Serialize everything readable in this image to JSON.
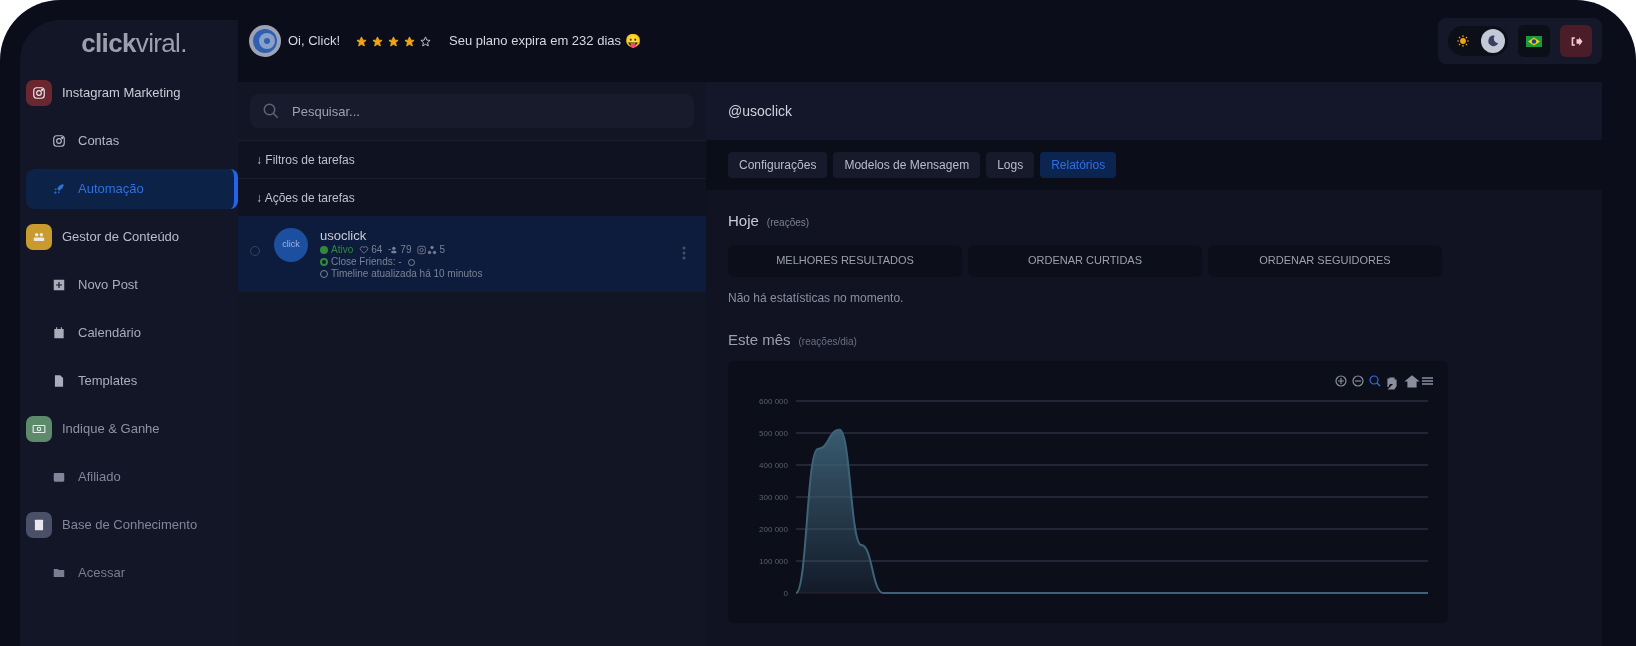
{
  "sidebar": {
    "logo": "**click**viral.",
    "groups": [
      {
        "title": "Instagram Marketing",
        "color": "#6b2630",
        "children": [
          {
            "label": "Contas",
            "selected": false
          },
          {
            "label": "Automação",
            "selected": true
          }
        ]
      },
      {
        "title": "Gestor de Conteúdo",
        "color": "#c99a2e",
        "children": [
          {
            "label": "Novo Post",
            "selected": false
          },
          {
            "label": "Calendário",
            "selected": false
          },
          {
            "label": "Templates",
            "selected": false
          }
        ]
      },
      {
        "title": "Indique & Ganhe",
        "color": "#5c8a6a",
        "children": [
          {
            "label": "Afiliado",
            "selected": false
          }
        ]
      },
      {
        "title": "Base de Conhecimento",
        "color": "#4a5068",
        "children": [
          {
            "label": "Acessar",
            "selected": false
          }
        ]
      }
    ]
  },
  "header": {
    "greeting": "Oi, Click!",
    "stars": 4,
    "plan": "Seu plano expira em 232 dias 😛",
    "theme_toggle": {
      "dark_selected": true
    }
  },
  "accounts_panel": {
    "search": {
      "placeholder": "Pesquisar..."
    },
    "sections": [
      "↓ Filtros de tarefas",
      "↓ Ações de tarefas"
    ],
    "accounts": [
      {
        "name": "usoclick",
        "avatar_text": "click",
        "selected": true,
        "checked": false,
        "status": "Ativo",
        "likes": "64",
        "followers": "79",
        "count": "5",
        "close_friends": "Close Friends: -",
        "timeline": "Timeline atualizada há 10 minutos"
      }
    ]
  },
  "detail": {
    "title": "@usoclick",
    "tabs": [
      {
        "label": "Configurações",
        "selected": false
      },
      {
        "label": "Modelos de Mensagem",
        "selected": false
      },
      {
        "label": "Logs",
        "selected": false
      },
      {
        "label": "Relatórios",
        "selected": true
      }
    ],
    "today": {
      "title": "Hoje",
      "unit": "(reações)",
      "buttons": [
        "MELHORES RESULTADOS",
        "ORDENAR CURTIDAS",
        "ORDENAR SEGUIDORES"
      ],
      "empty": "Não há estatísticas no momento."
    },
    "month": {
      "title": "Este mês",
      "unit": "(reações/dia)",
      "chart_data": {
        "type": "area",
        "grid": true,
        "ylim": [
          0,
          600000
        ],
        "yticks": [
          {
            "value": 0,
            "label": "0"
          },
          {
            "value": 100000,
            "label": "100 000"
          },
          {
            "value": 200000,
            "label": "200 000"
          },
          {
            "value": 300000,
            "label": "300 000"
          },
          {
            "value": 400000,
            "label": "400 000"
          },
          {
            "value": 500000,
            "label": "500 000"
          },
          {
            "value": 600000,
            "label": "600 000"
          }
        ],
        "series": [
          {
            "color": "#3d6378",
            "values": [
              0,
              450000,
              510000,
              150000,
              0,
              0,
              0,
              0,
              0,
              0,
              0,
              0,
              0,
              0,
              0,
              0,
              0,
              0,
              0,
              0,
              0,
              0,
              0,
              0,
              0,
              0,
              0,
              0,
              0,
              0
            ]
          }
        ]
      }
    }
  }
}
